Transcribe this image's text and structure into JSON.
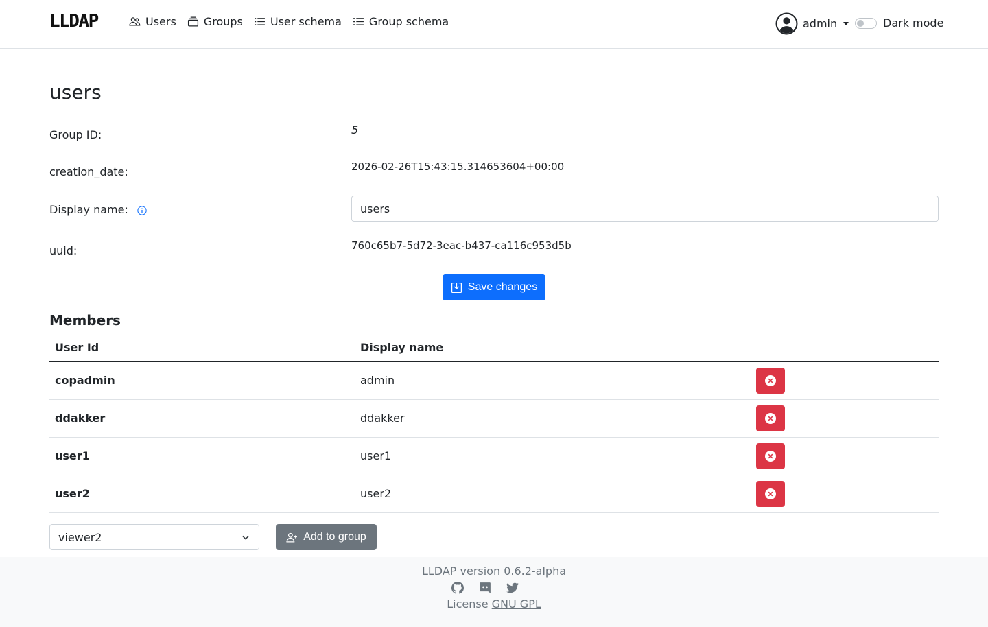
{
  "brand": "LLDAP",
  "nav": {
    "items": [
      {
        "label": "Users",
        "icon": "people-icon"
      },
      {
        "label": "Groups",
        "icon": "collection-icon"
      },
      {
        "label": "User schema",
        "icon": "list-icon"
      },
      {
        "label": "Group schema",
        "icon": "list-icon"
      }
    ],
    "user": {
      "name": "admin",
      "icon": "person-circle-icon"
    },
    "dark_mode": {
      "label": "Dark mode",
      "enabled": false
    }
  },
  "page": {
    "title": "users",
    "fields": {
      "group_id": {
        "label": "Group ID:",
        "value": "5"
      },
      "creation_date": {
        "label": "creation_date:",
        "value": "2026-02-26T15:43:15.314653604+00:00"
      },
      "display_name": {
        "label": "Display name:",
        "value": "users"
      },
      "uuid": {
        "label": "uuid:",
        "value": "760c65b7-5d72-3eac-b437-ca116c953d5b"
      }
    },
    "save_label": "Save changes"
  },
  "members": {
    "heading": "Members",
    "columns": [
      "User Id",
      "Display name"
    ],
    "rows": [
      {
        "user_id": "copadmin",
        "display_name": "admin"
      },
      {
        "user_id": "ddakker",
        "display_name": "ddakker"
      },
      {
        "user_id": "user1",
        "display_name": "user1"
      },
      {
        "user_id": "user2",
        "display_name": "user2"
      }
    ],
    "select_value": "viewer2",
    "add_label": "Add to group"
  },
  "footer": {
    "version": "LLDAP version 0.6.2-alpha",
    "license_prefix": "License",
    "license_link": "GNU GPL",
    "icons": [
      "github-icon",
      "discord-icon",
      "twitter-icon"
    ]
  },
  "colors": {
    "primary": "#0d6efd",
    "danger": "#dc3545",
    "secondary": "#6c757d",
    "info": "#0d6efd"
  }
}
